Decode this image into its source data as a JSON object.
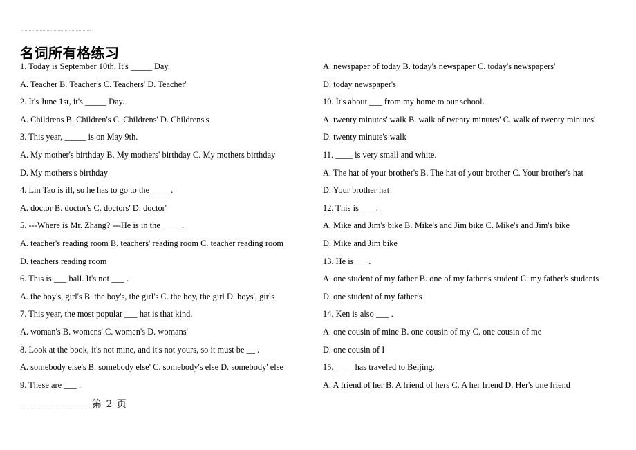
{
  "document": {
    "title": "名词所有格练习",
    "page_label": "第 2 页"
  },
  "left_column": {
    "lines": [
      {
        "id": "q1",
        "text": "1. Today is September 10th. It's _____ Day."
      },
      {
        "id": "q1-opts",
        "text": "A. Teacher      B. Teacher's      C. Teachers'      D. Teacher'"
      },
      {
        "id": "q2",
        "text": "2. It's June 1st, it's _____ Day."
      },
      {
        "id": "q2-opts",
        "text": "A. Childrens       B. Children's       C. Childrens'       D. Childrens's"
      },
      {
        "id": "q3",
        "text": "3. This year, _____ is on May 9th."
      },
      {
        "id": "q3-opts-abc",
        "text": "A. My mother's birthday        B. My mothers' birthday        C. My mothers birthday"
      },
      {
        "id": "q3-opt-d",
        "text": "D. My mothers's birthday"
      },
      {
        "id": "q4",
        "text": "4. Lin Tao is ill, so he has to go to the ____ ."
      },
      {
        "id": "q4-opts",
        "text": "A. doctor       B. doctor's      C. doctors'      D. doctor'"
      },
      {
        "id": "q5",
        "text": "5. ---Where is Mr. Zhang? ---He is in the ____ ."
      },
      {
        "id": "q5-opts-abc",
        "text": "A. teacher's reading room        B. teachers' reading room        C. teacher reading room"
      },
      {
        "id": "q5-opt-d",
        "text": "D. teachers reading room"
      },
      {
        "id": "q6",
        "text": "6. This is ___ ball. It's not ___ ."
      },
      {
        "id": "q6-opts",
        "text": "A. the boy's, girl's       B. the boy's, the girl's       C. the boy, the girl       D. boys', girls"
      },
      {
        "id": "q7",
        "text": "7. This year, the most popular ___ hat is that kind."
      },
      {
        "id": "q7-opts",
        "text": "A. woman's    B. womens'       C. women's       D. womans'"
      },
      {
        "id": "q8",
        "text": "8. Look at the book, it's not mine, and it's not yours, so it must be __ ."
      },
      {
        "id": "q8-opts",
        "text": "A. somebody else's       B. somebody else'       C. somebody's else       D. somebody' else"
      },
      {
        "id": "q9",
        "text": "9. These are ___ ."
      }
    ]
  },
  "right_column": {
    "lines": [
      {
        "id": "q9-opts-abc",
        "text": "A. newspaper of today       B. today's newspaper       C. today's newspapers'"
      },
      {
        "id": "q9-opt-d",
        "text": "D. today newspaper's"
      },
      {
        "id": "q10",
        "text": "10. It's about ___ from my home to our school."
      },
      {
        "id": "q10-opts-abc",
        "text": "A. twenty minutes' walk        B. walk of twenty minutes'        C. walk of twenty minutes'"
      },
      {
        "id": "q10-opt-d",
        "text": "D. twenty minute's walk"
      },
      {
        "id": "q11",
        "text": "11. ____ is very small and white."
      },
      {
        "id": "q11-opts-abc",
        "text": "A. The hat of your brother's        B. The hat of your brother        C. Your brother's hat"
      },
      {
        "id": "q11-opt-d",
        "text": "D. Your brother hat"
      },
      {
        "id": "q12",
        "text": "12. This is ___ ."
      },
      {
        "id": "q12-opts-abc",
        "text": "A. Mike and Jim's bike        B. Mike's and Jim bike        C. Mike's and Jim's bike"
      },
      {
        "id": "q12-opt-d",
        "text": "D. Mike and Jim bike"
      },
      {
        "id": "q13",
        "text": "13. He is ___."
      },
      {
        "id": "q13-opts-abc",
        "text": "A. one student of my father        B. one of my father's student        C. my father's students"
      },
      {
        "id": "q13-opt-d",
        "text": "D. one student of my father's"
      },
      {
        "id": "q14",
        "text": "14. Ken is also ___ ."
      },
      {
        "id": "q14-opts-abc",
        "text": "A. one cousin of mine       B. one cousin of my       C. one cousin of me"
      },
      {
        "id": "q14-opt-d",
        "text": "D. one cousin of I"
      },
      {
        "id": "q15",
        "text": "15. ____ has traveled to Beijing."
      },
      {
        "id": "q15-opts",
        "text": "A. A friend of her       B. A friend of hers       C. A her friend       D. Her's one friend"
      }
    ]
  },
  "colors": {
    "text": "#000000",
    "rule": "#b9b9b9",
    "footer_text": "#2a2a2a",
    "background": "#ffffff"
  }
}
